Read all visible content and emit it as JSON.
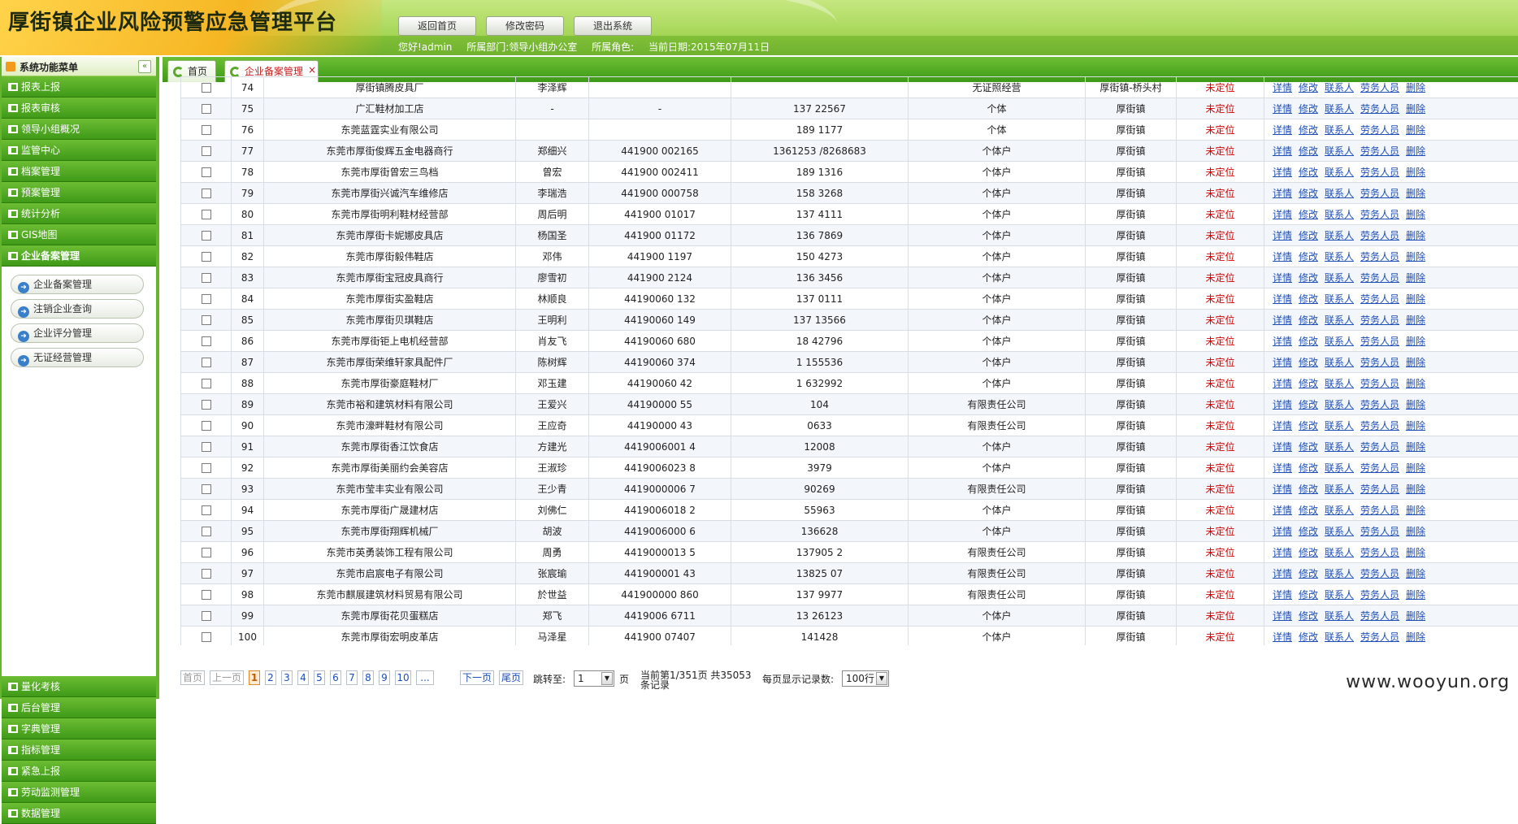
{
  "header": {
    "title": "厚街镇企业风险预警应急管理平台",
    "buttons": [
      "返回首页",
      "修改密码",
      "退出系统"
    ],
    "greeting": "您好!admin",
    "department": "所属部门:领导小组办公室",
    "role": "所属角色:",
    "date": "当前日期:2015年07月11日"
  },
  "sidebar": {
    "title": "系统功能菜单",
    "collapse_icon": "«",
    "items_top": [
      "报表上报",
      "报表审核",
      "领导小组概况",
      "监管中心",
      "档案管理",
      "预案管理",
      "统计分析",
      "GIS地图",
      "企业备案管理"
    ],
    "subitems": [
      "企业备案管理",
      "注销企业查询",
      "企业评分管理",
      "无证经营管理"
    ],
    "items_bottom": [
      "量化考核",
      "后台管理",
      "字典管理",
      "指标管理",
      "紧急上报",
      "劳动监测管理",
      "数据管理"
    ]
  },
  "tabs": [
    {
      "label": "首页",
      "icon": "refresh-icon"
    },
    {
      "label": "企业备案管理",
      "icon": "refresh-icon",
      "close": "×"
    }
  ],
  "table": {
    "ops": [
      "详情",
      "修改",
      "联系人",
      "劳务人员",
      "删除"
    ],
    "rows": [
      {
        "no": "74",
        "name": "厚街镇腾皮具厂",
        "person": "李泽辉",
        "id": "",
        "phone": "",
        "type": "无证照经营",
        "area": "厚街镇-桥头村",
        "status": "未定位"
      },
      {
        "no": "75",
        "name": "广汇鞋材加工店",
        "person": "-",
        "id": "-",
        "phone": "137 22567",
        "type": "个体",
        "area": "厚街镇",
        "status": "未定位"
      },
      {
        "no": "76",
        "name": "东莞蓝霆实业有限公司",
        "person": "",
        "id": "",
        "phone": "189 1177",
        "type": "个体",
        "area": "厚街镇",
        "status": "未定位"
      },
      {
        "no": "77",
        "name": "东莞市厚街俊辉五金电器商行",
        "person": "郑细兴",
        "id": "441900 002165",
        "phone": "1361253 /8268683",
        "type": "个体户",
        "area": "厚街镇",
        "status": "未定位"
      },
      {
        "no": "78",
        "name": "东莞市厚街曾宏三鸟档",
        "person": "曾宏",
        "id": "441900 002411",
        "phone": "189 1316",
        "type": "个体户",
        "area": "厚街镇",
        "status": "未定位"
      },
      {
        "no": "79",
        "name": "东莞市厚街兴诚汽车维修店",
        "person": "李瑞浩",
        "id": "441900 000758",
        "phone": "158 3268",
        "type": "个体户",
        "area": "厚街镇",
        "status": "未定位"
      },
      {
        "no": "80",
        "name": "东莞市厚街明利鞋材经营部",
        "person": "周后明",
        "id": "441900 01017",
        "phone": "137 4111",
        "type": "个体户",
        "area": "厚街镇",
        "status": "未定位"
      },
      {
        "no": "81",
        "name": "东莞市厚街卡妮娜皮具店",
        "person": "杨国圣",
        "id": "441900 01172",
        "phone": "136 7869",
        "type": "个体户",
        "area": "厚街镇",
        "status": "未定位"
      },
      {
        "no": "82",
        "name": "东莞市厚街毅伟鞋店",
        "person": "邓伟",
        "id": "441900 1197",
        "phone": "150 4273",
        "type": "个体户",
        "area": "厚街镇",
        "status": "未定位"
      },
      {
        "no": "83",
        "name": "东莞市厚街宝冠皮具商行",
        "person": "廖雪初",
        "id": "441900 2124",
        "phone": "136 3456",
        "type": "个体户",
        "area": "厚街镇",
        "status": "未定位"
      },
      {
        "no": "84",
        "name": "东莞市厚街实盈鞋店",
        "person": "林顺良",
        "id": "44190060 132",
        "phone": "137 0111",
        "type": "个体户",
        "area": "厚街镇",
        "status": "未定位"
      },
      {
        "no": "85",
        "name": "东莞市厚街贝琪鞋店",
        "person": "王明利",
        "id": "44190060 149",
        "phone": "137 13566",
        "type": "个体户",
        "area": "厚街镇",
        "status": "未定位"
      },
      {
        "no": "86",
        "name": "东莞市厚街钜上电机经营部",
        "person": "肖友飞",
        "id": "44190060 680",
        "phone": "18 42796",
        "type": "个体户",
        "area": "厚街镇",
        "status": "未定位"
      },
      {
        "no": "87",
        "name": "东莞市厚街荣维轩家具配件厂",
        "person": "陈树辉",
        "id": "44190060 374",
        "phone": "1 155536",
        "type": "个体户",
        "area": "厚街镇",
        "status": "未定位"
      },
      {
        "no": "88",
        "name": "东莞市厚街豪庭鞋材厂",
        "person": "邓玉建",
        "id": "44190060 42",
        "phone": "1 632992",
        "type": "个体户",
        "area": "厚街镇",
        "status": "未定位"
      },
      {
        "no": "89",
        "name": "东莞市裕和建筑材料有限公司",
        "person": "王爱兴",
        "id": "44190000 55",
        "phone": "104",
        "type": "有限责任公司",
        "area": "厚街镇",
        "status": "未定位"
      },
      {
        "no": "90",
        "name": "东莞市濠畔鞋材有限公司",
        "person": "王应奇",
        "id": "44190000 43",
        "phone": "0633",
        "type": "有限责任公司",
        "area": "厚街镇",
        "status": "未定位"
      },
      {
        "no": "91",
        "name": "东莞市厚街香江饮食店",
        "person": "方建光",
        "id": "4419006001 4",
        "phone": "12008",
        "type": "个体户",
        "area": "厚街镇",
        "status": "未定位"
      },
      {
        "no": "92",
        "name": "东莞市厚街美丽约会美容店",
        "person": "王淑珍",
        "id": "4419006023 8",
        "phone": "3979",
        "type": "个体户",
        "area": "厚街镇",
        "status": "未定位"
      },
      {
        "no": "93",
        "name": "东莞市莹丰实业有限公司",
        "person": "王少青",
        "id": "4419000006 7",
        "phone": "90269",
        "type": "有限责任公司",
        "area": "厚街镇",
        "status": "未定位"
      },
      {
        "no": "94",
        "name": "东莞市厚街广晟建材店",
        "person": "刘佛仁",
        "id": "4419006018 2",
        "phone": "55963",
        "type": "个体户",
        "area": "厚街镇",
        "status": "未定位"
      },
      {
        "no": "95",
        "name": "东莞市厚街翔辉机械厂",
        "person": "胡波",
        "id": "4419006000 6",
        "phone": "136628",
        "type": "个体户",
        "area": "厚街镇",
        "status": "未定位"
      },
      {
        "no": "96",
        "name": "东莞市英勇装饰工程有限公司",
        "person": "周勇",
        "id": "4419000013 5",
        "phone": "137905 2",
        "type": "有限责任公司",
        "area": "厚街镇",
        "status": "未定位"
      },
      {
        "no": "97",
        "name": "东莞市启宸电子有限公司",
        "person": "张宸瑜",
        "id": "441900001 43",
        "phone": "13825 07",
        "type": "有限责任公司",
        "area": "厚街镇",
        "status": "未定位"
      },
      {
        "no": "98",
        "name": "东莞市麒展建筑材料贸易有限公司",
        "person": "於世益",
        "id": "441900000 860",
        "phone": "137 9977",
        "type": "有限责任公司",
        "area": "厚街镇",
        "status": "未定位"
      },
      {
        "no": "99",
        "name": "东莞市厚街花贝蛋糕店",
        "person": "郑飞",
        "id": "4419006 6711",
        "phone": "13 26123",
        "type": "个体户",
        "area": "厚街镇",
        "status": "未定位"
      },
      {
        "no": "100",
        "name": "东莞市厚街宏明皮革店",
        "person": "马泽星",
        "id": "441900 07407",
        "phone": "141428",
        "type": "个体户",
        "area": "厚街镇",
        "status": "未定位"
      }
    ]
  },
  "pager": {
    "first": "首页",
    "prev": "上一页",
    "pages": [
      "1",
      "2",
      "3",
      "4",
      "5",
      "6",
      "7",
      "8",
      "9",
      "10"
    ],
    "ellipsis": "...",
    "next": "下一页",
    "last": "尾页",
    "jump_label": "跳转至:",
    "jump_value": "1",
    "page_unit": "页",
    "summary_line1": "当前第1/351页 共35053",
    "summary_line2": "条记录",
    "per_page_label": "每页显示记录数:",
    "per_page_value": "100行",
    "current_page": "1"
  },
  "watermark": "www.wooyun.org"
}
